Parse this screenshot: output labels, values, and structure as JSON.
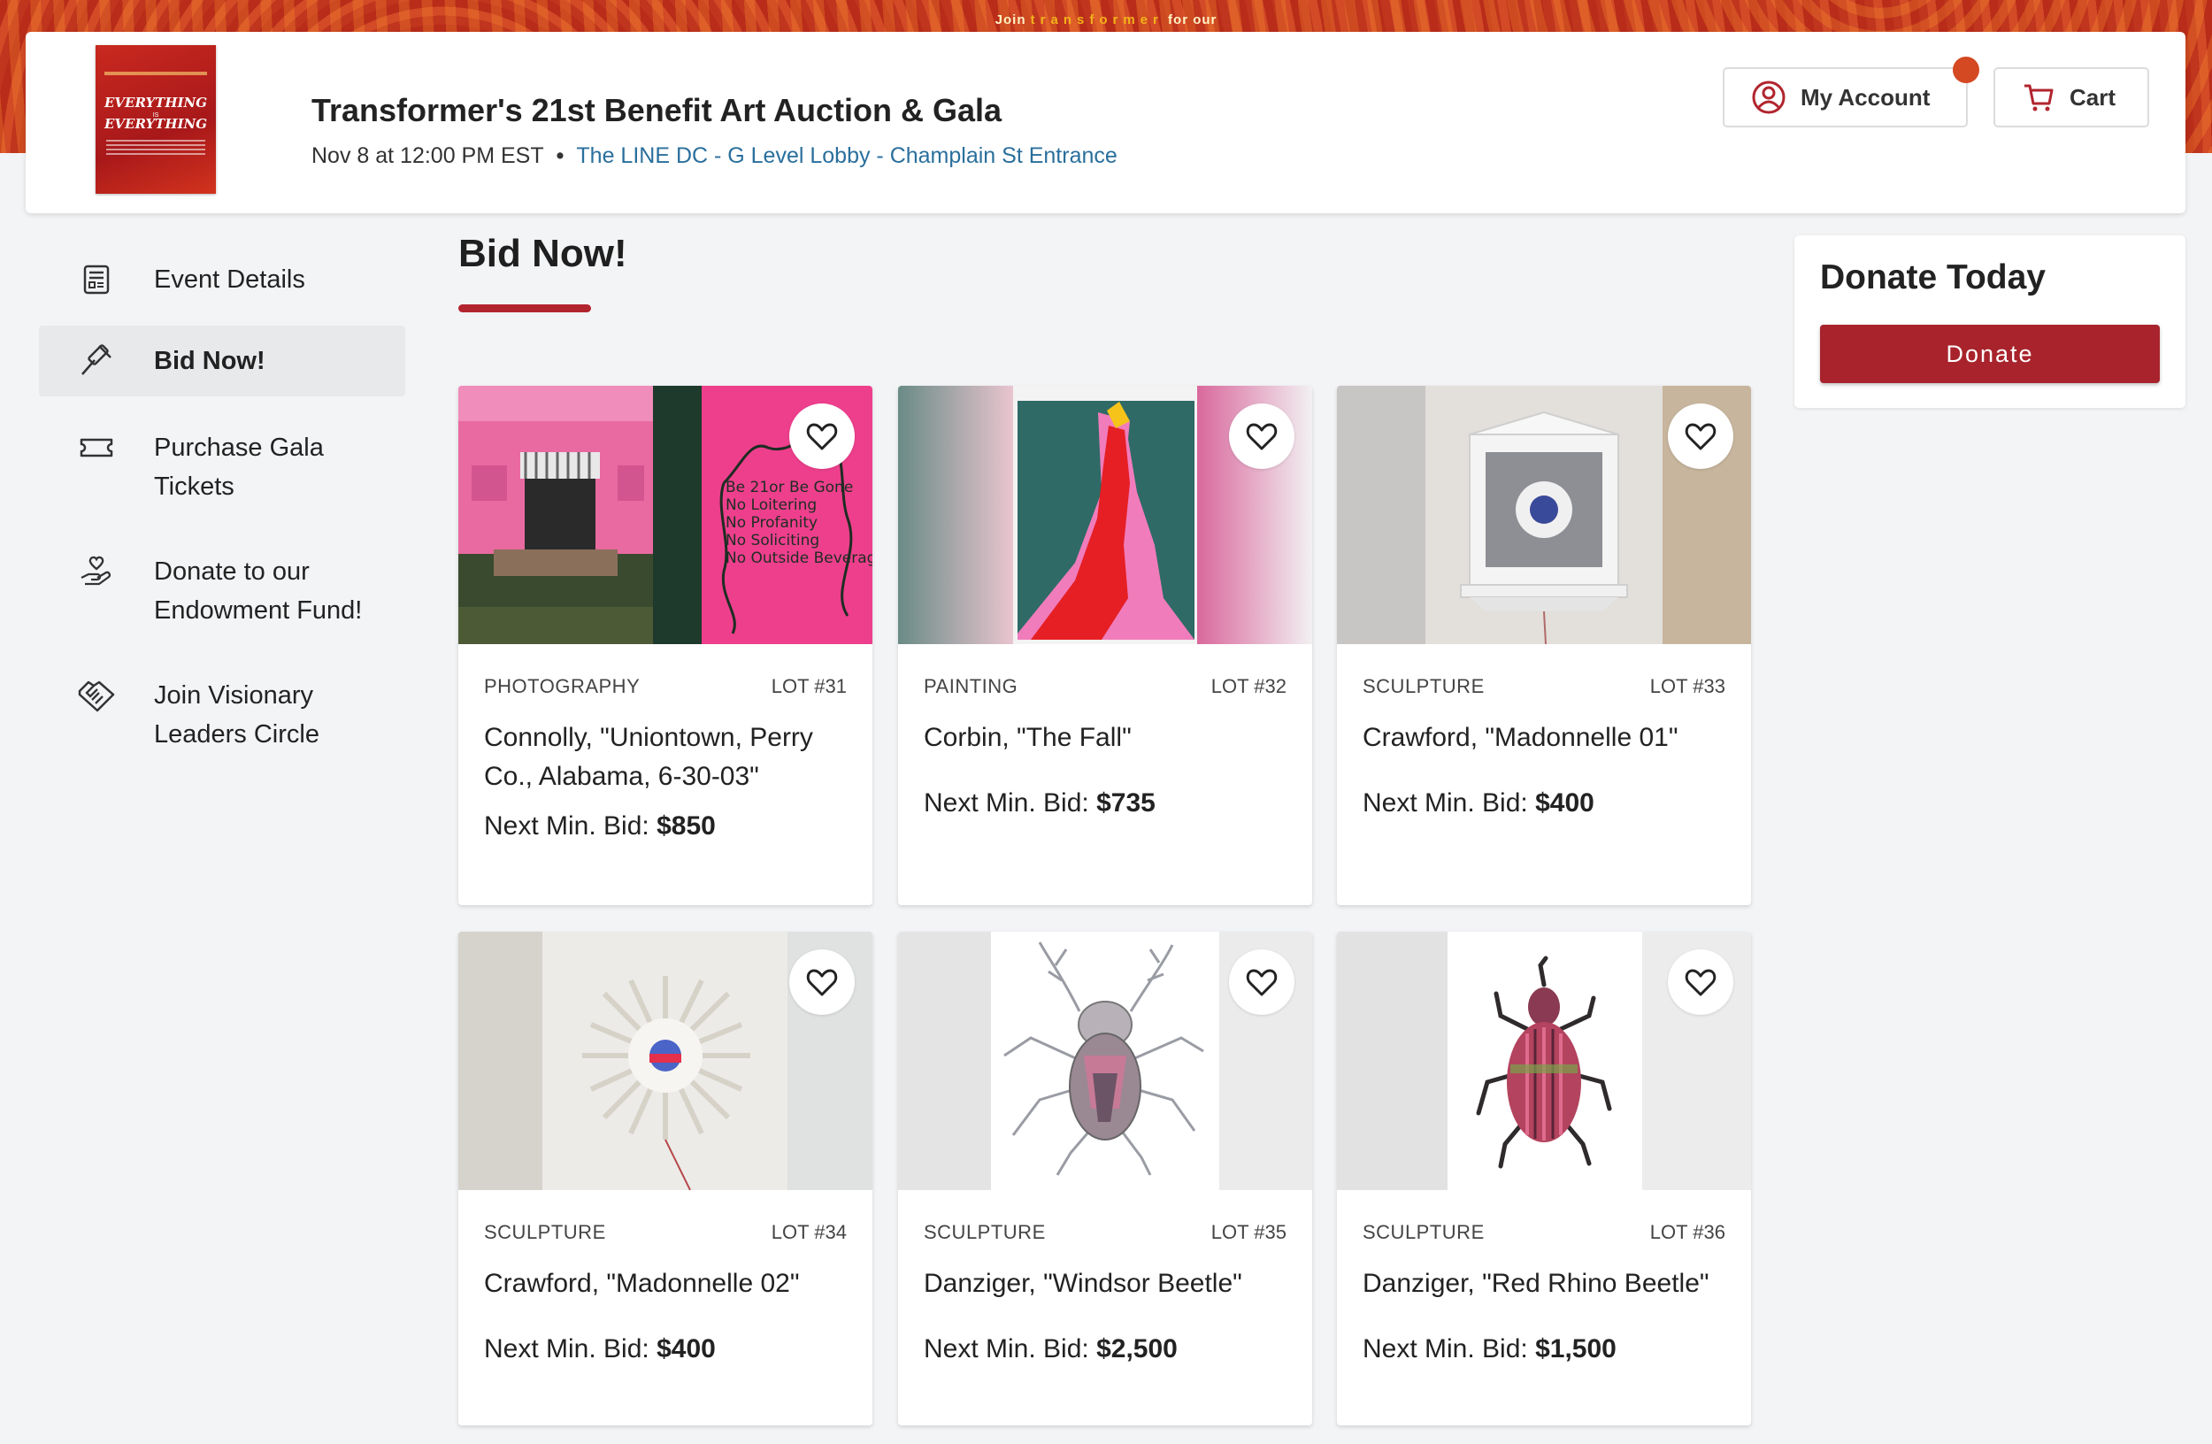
{
  "banner": {
    "prefix": "Join",
    "brand": "transformer",
    "suffix": "for our"
  },
  "header": {
    "poster_line1": "EVERYTHING",
    "poster_small": "IS",
    "poster_line2": "EVERYTHING",
    "title": "Transformer's 21st Benefit Art Auction & Gala",
    "date": "Nov 8 at 12:00 PM EST",
    "separator": "•",
    "venue": "The LINE DC - G Level Lobby - Champlain St Entrance",
    "account_label": "My Account",
    "cart_label": "Cart"
  },
  "sidebar": {
    "items": [
      {
        "label": "Event Details",
        "icon": "document-icon"
      },
      {
        "label": "Bid Now!",
        "icon": "gavel-icon",
        "active": true
      },
      {
        "label": "Purchase Gala Tickets",
        "icon": "ticket-icon"
      },
      {
        "label": "Donate to our Endowment Fund!",
        "icon": "hand-heart-icon"
      },
      {
        "label": "Join Visionary Leaders Circle",
        "icon": "handshake-icon"
      }
    ]
  },
  "main": {
    "title": "Bid Now!",
    "bid_prefix": "Next Min. Bid:",
    "lots": [
      {
        "category": "PHOTOGRAPHY",
        "lot": "LOT #31",
        "name": "Connolly, \"Uniontown, Perry Co., Alabama, 6-30-03\"",
        "bid": "$850"
      },
      {
        "category": "PAINTING",
        "lot": "LOT #32",
        "name": "Corbin, \"The Fall\"",
        "bid": "$735"
      },
      {
        "category": "SCULPTURE",
        "lot": "LOT #33",
        "name": "Crawford, \"Madonnelle 01\"",
        "bid": "$400"
      },
      {
        "category": "SCULPTURE",
        "lot": "LOT #34",
        "name": "Crawford, \"Madonnelle 02\"",
        "bid": "$400"
      },
      {
        "category": "SCULPTURE",
        "lot": "LOT #35",
        "name": "Danziger, \"Windsor Beetle\"",
        "bid": "$2,500"
      },
      {
        "category": "SCULPTURE",
        "lot": "LOT #36",
        "name": "Danziger, \"Red Rhino Beetle\"",
        "bid": "$1,500"
      }
    ],
    "photo_wall_text": "Be 21 or Be Gone No Loitering No Profanity No Soliciting No Outside Beverages"
  },
  "donate": {
    "title": "Donate Today",
    "button_label": "Donate"
  },
  "colors": {
    "accent": "#a8232b",
    "link": "#2a6f9c",
    "notification": "#d44822"
  }
}
